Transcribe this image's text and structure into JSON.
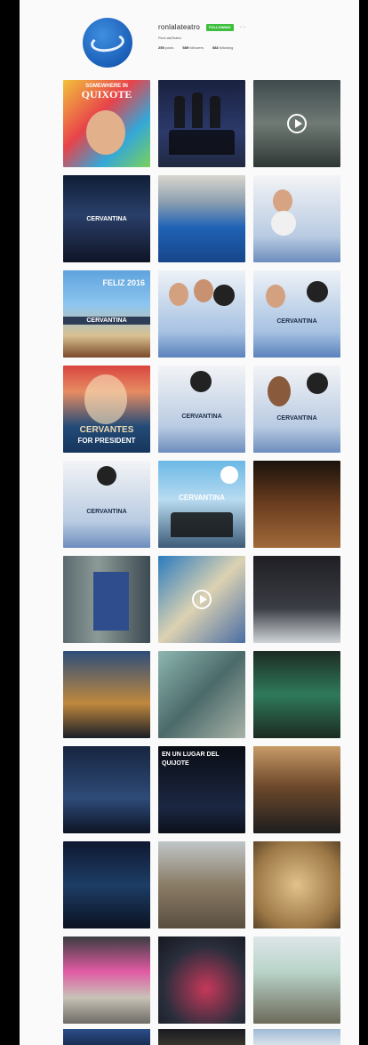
{
  "profile": {
    "username": "ronlalateatro",
    "follow_label": "FOLLOWING",
    "more_label": "···",
    "full_name": "RonLalaTeatro",
    "stats": [
      {
        "count": "255",
        "label": "posts"
      },
      {
        "count": "589",
        "label": "followers"
      },
      {
        "count": "583",
        "label": "following"
      }
    ]
  },
  "posts": [
    {
      "caption": "SOMEWHERE IN",
      "caption2": "QUIXOTE"
    },
    {},
    {
      "video": true
    },
    {
      "caption": "CERVANTINA"
    },
    {},
    {},
    {
      "caption": "FELIZ 2016",
      "caption2": "CERVANTINA"
    },
    {},
    {
      "caption": "CERVANTINA"
    },
    {
      "caption": "CERVANTES",
      "caption2": "FOR PRESIDENT"
    },
    {
      "caption": "CERVANTINA"
    },
    {
      "caption": "CERVANTINA"
    },
    {
      "caption": "CERVANTINA"
    },
    {
      "caption": "CERVANTINA"
    },
    {},
    {},
    {
      "video": true
    },
    {},
    {},
    {},
    {},
    {},
    {
      "caption": "EN UN LUGAR DEL",
      "caption2": "QUIJOTE"
    },
    {},
    {},
    {},
    {},
    {},
    {},
    {}
  ]
}
